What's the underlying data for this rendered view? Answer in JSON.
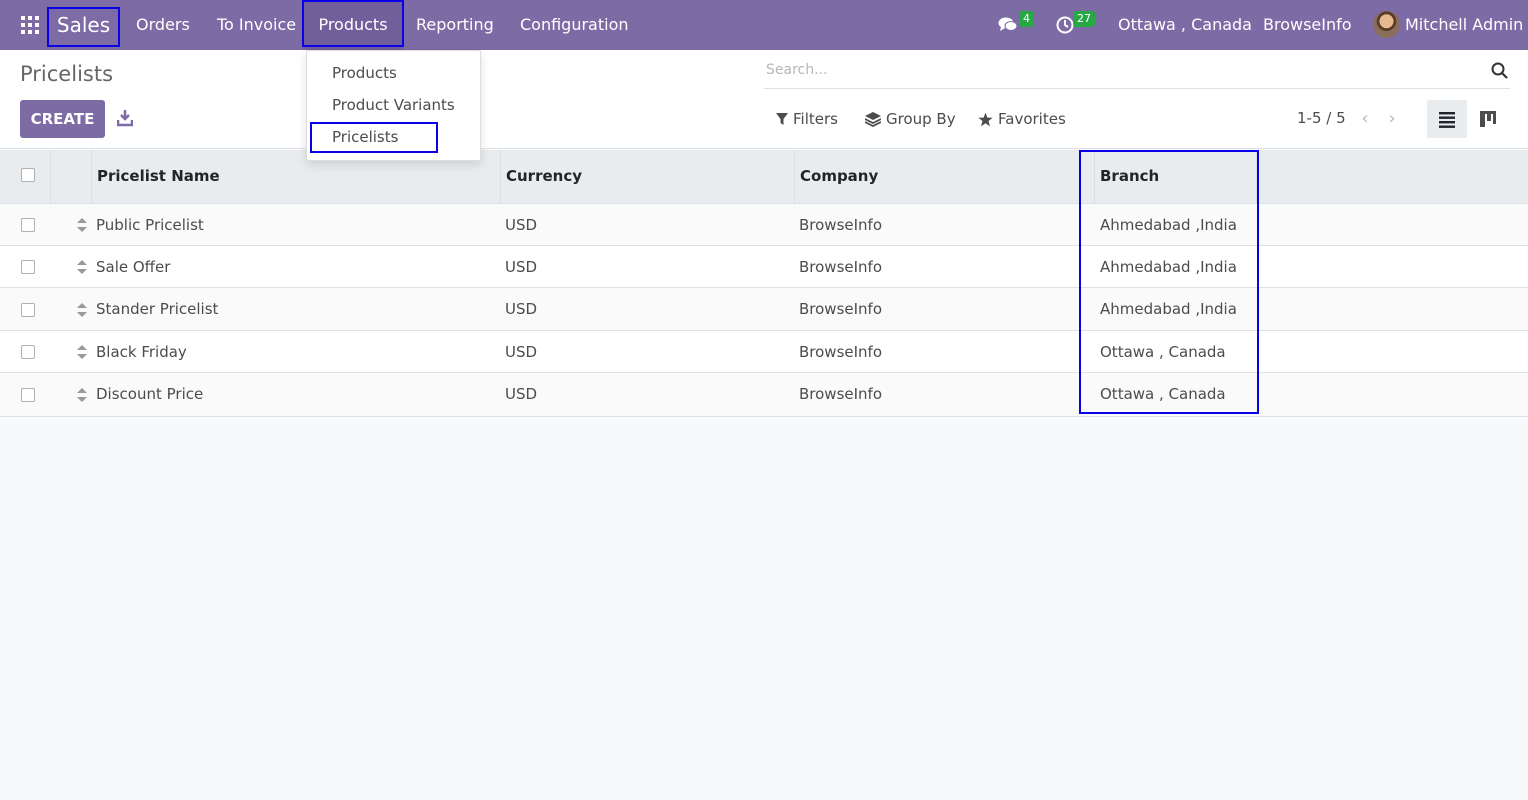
{
  "navbar": {
    "app_name": "Sales",
    "menu": [
      "Orders",
      "To Invoice",
      "Products",
      "Reporting",
      "Configuration"
    ],
    "messages_count": "4",
    "activities_count": "27",
    "branch": "Ottawa , Canada",
    "company": "BrowseInfo",
    "user": "Mitchell Admin",
    "bg_color": "#7c6ba5"
  },
  "dropdown": {
    "items": [
      "Products",
      "Product Variants",
      "Pricelists"
    ]
  },
  "control": {
    "title": "Pricelists",
    "create_label": "CREATE",
    "search_placeholder": "Search...",
    "filters_label": "Filters",
    "group_by_label": "Group By",
    "favorites_label": "Favorites",
    "pager": "1-5 / 5"
  },
  "table": {
    "columns": [
      "Pricelist Name",
      "Currency",
      "Company",
      "Branch"
    ],
    "rows": [
      {
        "name": "Public Pricelist",
        "currency": "USD",
        "company": "BrowseInfo",
        "branch": "Ahmedabad ,India"
      },
      {
        "name": "Sale Offer",
        "currency": "USD",
        "company": "BrowseInfo",
        "branch": "Ahmedabad ,India"
      },
      {
        "name": "Stander Pricelist",
        "currency": "USD",
        "company": "BrowseInfo",
        "branch": "Ahmedabad ,India"
      },
      {
        "name": "Black Friday",
        "currency": "USD",
        "company": "BrowseInfo",
        "branch": "Ottawa , Canada"
      },
      {
        "name": "Discount Price",
        "currency": "USD",
        "company": "BrowseInfo",
        "branch": "Ottawa , Canada"
      }
    ]
  },
  "highlight_color": "#0a00e8"
}
